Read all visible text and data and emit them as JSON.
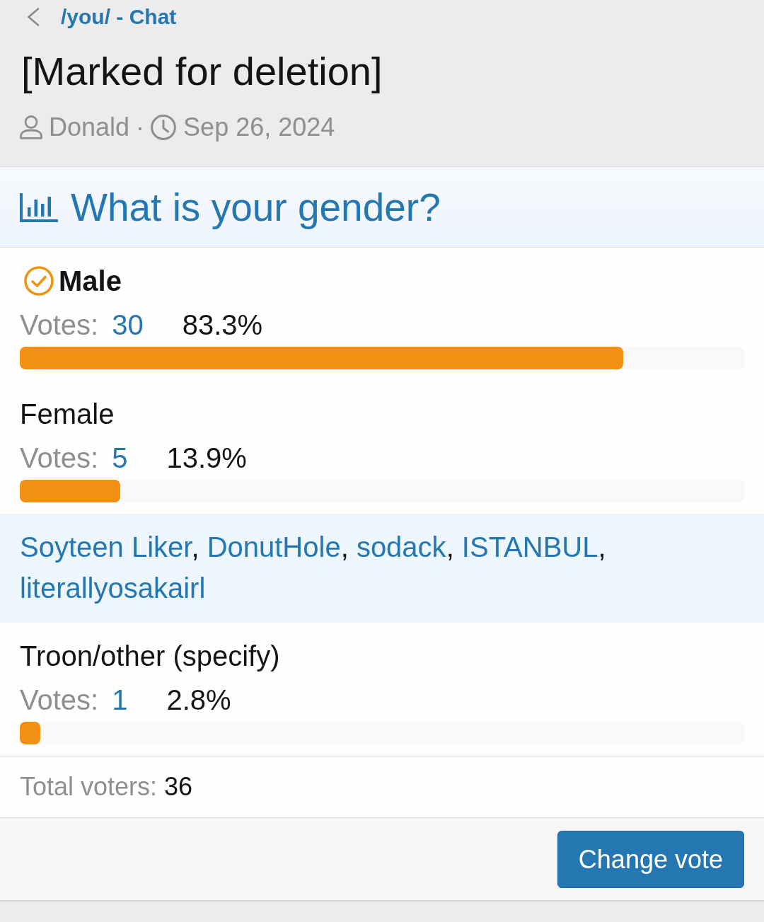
{
  "breadcrumb": {
    "label": "/you/ - Chat"
  },
  "thread": {
    "title": "[Marked for deletion]",
    "author": "Donald",
    "separator": "·",
    "date": "Sep 26, 2024"
  },
  "poll": {
    "question": "What is your gender?",
    "options": [
      {
        "label": "Male",
        "selected": true,
        "votes_label": "Votes:",
        "votes": "30",
        "percent": "83.3%",
        "level": 0.833
      },
      {
        "label": "Female",
        "selected": false,
        "votes_label": "Votes:",
        "votes": "5",
        "percent": "13.9%",
        "level": 0.139,
        "voters": {
          "names": [
            "Soyteen Liker",
            "DonutHole",
            "sodack",
            "ISTANBUL",
            "literallyosakairl"
          ],
          "separator": ","
        }
      },
      {
        "label": "Troon/other (specify)",
        "selected": false,
        "votes_label": "Votes:",
        "votes": "1",
        "percent": "2.8%",
        "level": 0.028
      }
    ],
    "total": {
      "label": "Total voters:",
      "value": "36"
    },
    "buttons": [
      {
        "label": "Change vote"
      }
    ]
  }
}
